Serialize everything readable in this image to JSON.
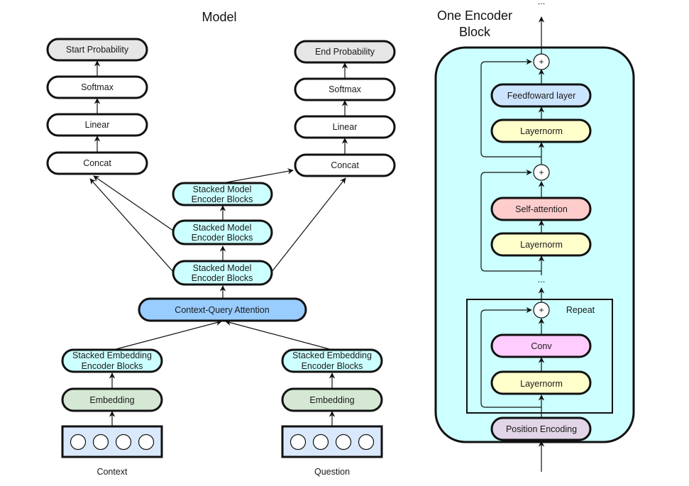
{
  "titles": {
    "model": "Model",
    "encoder_block_line1": "One Encoder",
    "encoder_block_line2": "Block"
  },
  "model": {
    "start_branch": {
      "output": "Start Probability",
      "softmax": "Softmax",
      "linear": "Linear",
      "concat": "Concat"
    },
    "end_branch": {
      "output": "End Probability",
      "softmax": "Softmax",
      "linear": "Linear",
      "concat": "Concat"
    },
    "model_encoders": [
      {
        "line1": "Stacked Model",
        "line2": "Encoder Blocks"
      },
      {
        "line1": "Stacked Model",
        "line2": "Encoder Blocks"
      },
      {
        "line1": "Stacked Model",
        "line2": "Encoder Blocks"
      }
    ],
    "attention": "Context-Query Attention",
    "context_side": {
      "embedding_encoder_line1": "Stacked Embedding",
      "embedding_encoder_line2": "Encoder Blocks",
      "embedding": "Embedding",
      "input_label": "Context",
      "token_count": 4
    },
    "question_side": {
      "embedding_encoder_line1": "Stacked Embedding",
      "embedding_encoder_line2": "Encoder Blocks",
      "embedding": "Embedding",
      "input_label": "Question",
      "token_count": 4
    }
  },
  "encoder_block": {
    "ellipsis_top": "...",
    "ellipsis_middle": "...",
    "feedforward": "Feedfoward layer",
    "layernorm_ff": "Layernorm",
    "self_attention": "Self-attention",
    "layernorm_sa": "Layernorm",
    "repeat_label": "Repeat",
    "conv": "Conv",
    "layernorm_conv": "Layernorm",
    "position_encoding": "Position Encoding",
    "plus_symbol": "+"
  },
  "colors": {
    "white_node": "#ffffff",
    "output_node": "#e6e6e6",
    "model_encoder": "#ccffff",
    "attention": "#99ccff",
    "embedding": "#d5e8d4",
    "input_box": "#dae8fc",
    "block_bg": "#ccffff",
    "feedforward": "#cce5ff",
    "layernorm": "#ffffcc",
    "self_attention": "#ffcccc",
    "conv": "#ffccff",
    "position_encoding": "#e1d5e7"
  }
}
